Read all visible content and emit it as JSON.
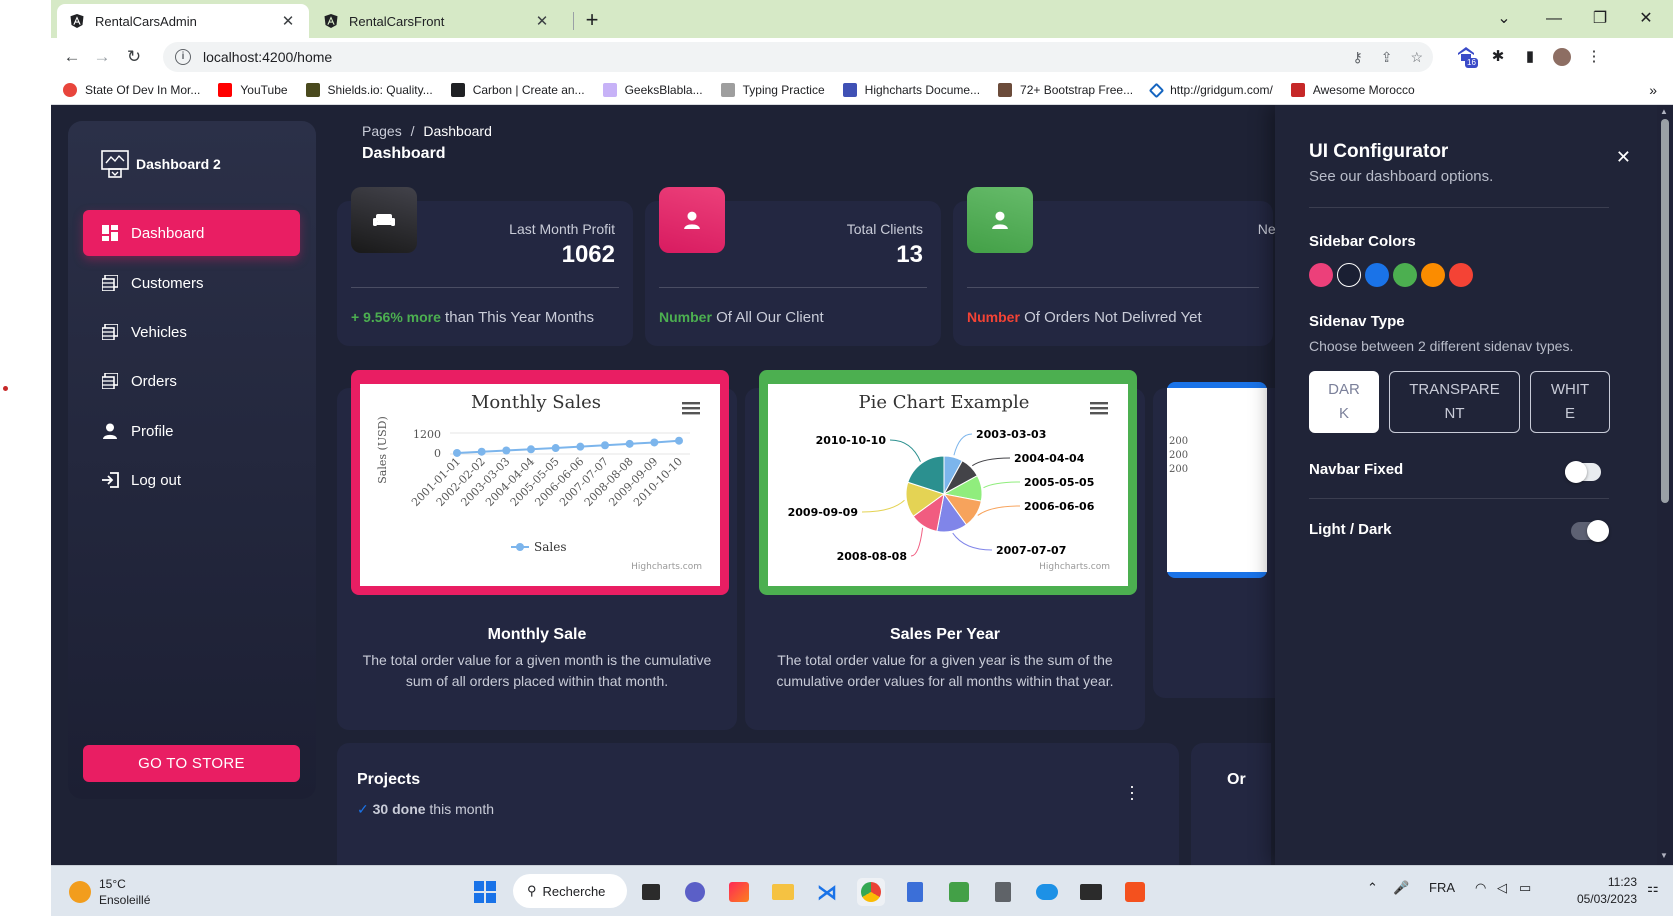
{
  "browser": {
    "tabs": [
      {
        "title": "RentalCarsAdmin",
        "active": true
      },
      {
        "title": "RentalCarsFront",
        "active": false
      }
    ],
    "url": "localhost:4200/home",
    "extension_badge": "16",
    "bookmarks": [
      "State Of Dev In Mor...",
      "YouTube",
      "Shields.io: Quality...",
      "Carbon | Create an...",
      "GeeksBlabla...",
      "Typing Practice",
      "Highcharts Docume...",
      "72+ Bootstrap Free...",
      "http://gridgum.com/",
      "Awesome Morocco"
    ],
    "bookmarks_more": "»"
  },
  "sidebar": {
    "brand": "Dashboard 2",
    "items": [
      {
        "label": "Dashboard",
        "icon": "dashboard-icon",
        "active": true
      },
      {
        "label": "Customers",
        "icon": "table-icon"
      },
      {
        "label": "Vehicles",
        "icon": "table-icon"
      },
      {
        "label": "Orders",
        "icon": "table-icon"
      },
      {
        "label": "Profile",
        "icon": "person-icon"
      },
      {
        "label": "Log out",
        "icon": "logout-icon"
      }
    ],
    "store_button": "GO TO STORE"
  },
  "header": {
    "breadcrumb_root": "Pages",
    "breadcrumb_sep": "/",
    "breadcrumb_current": "Dashboard",
    "title": "Dashboard"
  },
  "stats": [
    {
      "label": "Last Month Profit",
      "value": "1062",
      "highlight": "+ 9.56% more",
      "rest": " than This Year Months",
      "highlight_color": "#4caf50"
    },
    {
      "label": "Total Clients",
      "value": "13",
      "highlight": "Number",
      "rest": " Of All Our Client",
      "highlight_color": "#4caf50"
    },
    {
      "label": "New Ord",
      "value": "",
      "highlight": "Number",
      "rest": " Of Orders Not Delivred Yet",
      "highlight_color": "#f44335"
    }
  ],
  "charts": [
    {
      "card_title": "Monthly Sale",
      "card_desc": "The total order value for a given month is the cumulative sum of all orders placed within that month.",
      "accent": "#e91e63"
    },
    {
      "card_title": "Sales Per Year",
      "card_desc": "The total order value for a given year is the sum of the cumulative order values for all months within that year.",
      "accent": "#4caf50"
    }
  ],
  "chart_data": [
    {
      "type": "line",
      "title": "Monthly Sales",
      "ylabel": "Sales (USD)",
      "legend": "Sales",
      "credit": "Highcharts.com",
      "yticks": [
        "1200",
        "0"
      ],
      "categories": [
        "2001-01-01",
        "2002-02-02",
        "2003-03-03",
        "2004-04-04",
        "2005-05-05",
        "2006-06-06",
        "2007-07-07",
        "2008-08-08",
        "2009-09-09",
        "2010-10-10"
      ],
      "values": [
        60,
        130,
        200,
        270,
        340,
        420,
        500,
        580,
        660,
        760
      ],
      "ylim": [
        0,
        1200
      ]
    },
    {
      "type": "pie",
      "title": "Pie Chart Example",
      "credit": "Highcharts.com",
      "labels": [
        "2003-03-03",
        "2004-04-04",
        "2005-05-05",
        "2006-06-06",
        "2007-07-07",
        "2008-08-08",
        "2009-09-09",
        "2010-10-10"
      ],
      "values": [
        8,
        9,
        11,
        12,
        13,
        12,
        15,
        20
      ]
    }
  ],
  "third_chart_ticks": [
    "200",
    "200",
    "200"
  ],
  "projects": {
    "title": "Projects",
    "done": "30 done",
    "sub": " this month",
    "next_title": "Or"
  },
  "configurator": {
    "title": "UI Configurator",
    "subtitle": "See our dashboard options.",
    "sidebar_colors_label": "Sidebar Colors",
    "swatches": [
      "#ec407a",
      "#1a1f33",
      "#1a73e8",
      "#4caf50",
      "#fb8c00",
      "#f44335"
    ],
    "sidenav_type_label": "Sidenav Type",
    "sidenav_type_desc": "Choose between 2 different sidenav types.",
    "types": [
      "DAR\nK",
      "TRANSPARE\nNT",
      "WHIT\nE"
    ],
    "navbar_fixed_label": "Navbar Fixed",
    "navbar_fixed_on": false,
    "light_dark_label": "Light / Dark",
    "light_dark_on": true
  },
  "taskbar": {
    "temp": "15°C",
    "weather": "Ensoleillé",
    "search": "Recherche",
    "lang": "FRA",
    "time": "11:23",
    "date": "05/03/2023"
  }
}
